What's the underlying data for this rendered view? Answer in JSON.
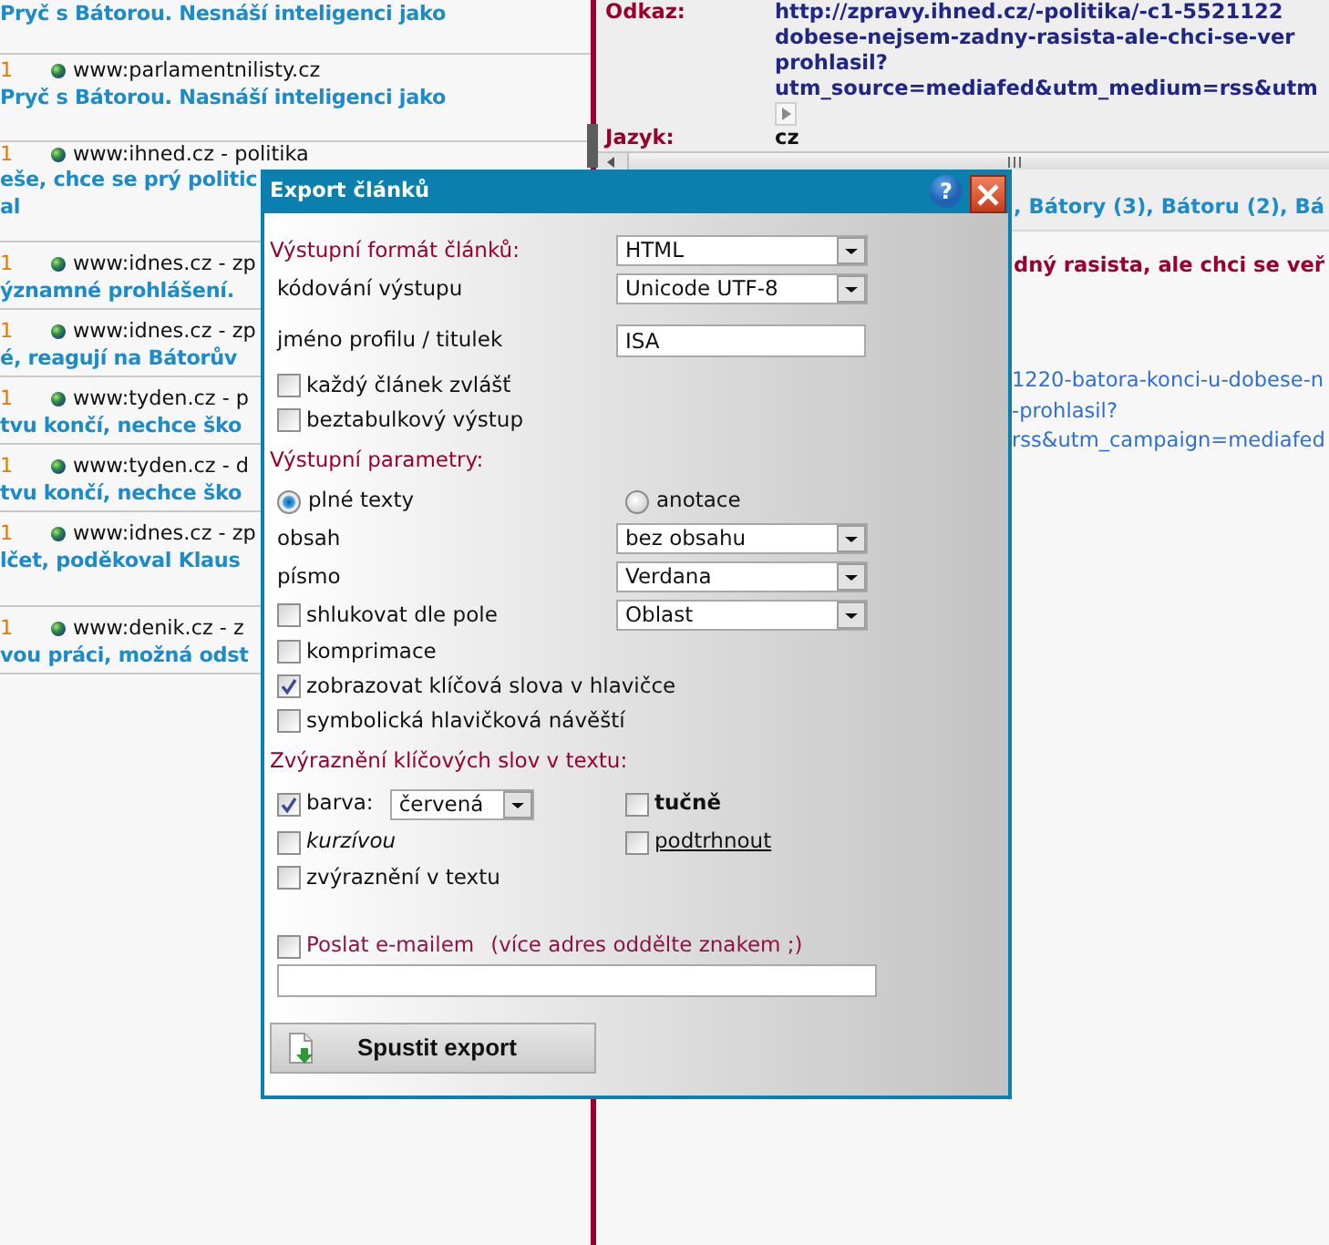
{
  "article_list": [
    {
      "title_lines": [
        "Pryč s Bátorou. Nesnáší inteligenci jako"
      ]
    },
    {
      "count": "1",
      "source": "www:parlamentnilisty.cz",
      "title_lines": [
        "Pryč s Bátorou. Nasnáší inteligenci jako"
      ]
    },
    {
      "count": "1",
      "source": "www:ihned.cz - politika",
      "title_lines": [
        "eše, chce se prý politic",
        "al"
      ]
    },
    {
      "count": "1",
      "source": "www:idnes.cz - zp",
      "title_lines": [
        "ýznamné prohlášení."
      ]
    },
    {
      "count": "1",
      "source": "www:idnes.cz - zp",
      "title_lines": [
        "é, reagují na Bátorův"
      ]
    },
    {
      "count": "1",
      "source": "www:tyden.cz - p",
      "title_lines": [
        "tvu končí, nechce ško"
      ]
    },
    {
      "count": "1",
      "source": "www:tyden.cz - d",
      "title_lines": [
        "tvu končí, nechce ško"
      ]
    },
    {
      "count": "1",
      "source": "www:idnes.cz - zp",
      "title_lines": [
        "lčet, poděkoval Klaus"
      ]
    },
    {
      "count": "1",
      "source": "www:denik.cz - z",
      "title_lines": [
        "vou práci, možná odst"
      ]
    }
  ],
  "detail": {
    "fields": [
      {
        "kind": "link",
        "label": "Odkaz:",
        "lines": [
          "http://zpravy.ihned.cz/-politika/-c1-5521122",
          "dobese-nejsem-zadny-rasista-ale-chci-se-ver",
          "prohlasil?",
          "utm_source=mediafed&utm_medium=rss&utm"
        ]
      },
      {
        "kind": "text",
        "label": "Jazyk:",
        "lines": [
          "cz"
        ]
      }
    ]
  },
  "article_preview": {
    "keywords": ", Bátory (3), Bátoru (2), Bá",
    "headline": "dný rasista, ale chci se veř",
    "link_lines": [
      "1220-batora-konci-u-dobese-n",
      "-prohlasil?",
      "rss&utm_campaign=mediafed"
    ]
  },
  "dialog": {
    "title": "Export článků",
    "help": "?",
    "rows": [
      {
        "kind": "select",
        "label": "Výstupní formát článků:",
        "accent": true,
        "value": "HTML"
      },
      {
        "kind": "select",
        "label": "kódování výstupu",
        "accent": false,
        "value": "Unicode UTF-8"
      },
      {
        "kind": "text",
        "label": "jméno profilu / titulek",
        "value": "ISA"
      },
      {
        "kind": "checkbox",
        "label": "každý článek zvlášť",
        "checked": false
      },
      {
        "kind": "checkbox",
        "label": "beztabulkový výstup",
        "checked": false
      },
      {
        "kind": "heading",
        "label": "Výstupní parametry:"
      },
      {
        "kind": "radios",
        "options": [
          {
            "label": "plné texty",
            "selected": true
          },
          {
            "label": "anotace",
            "selected": false
          }
        ]
      },
      {
        "kind": "select",
        "label": "obsah",
        "accent": false,
        "value": "bez obsahu"
      },
      {
        "kind": "select",
        "label": "písmo",
        "accent": false,
        "value": "Verdana"
      },
      {
        "kind": "checkbox_select",
        "label": "shlukovat dle pole",
        "checked": false,
        "value": "Oblast"
      },
      {
        "kind": "checkbox",
        "label": "komprimace",
        "checked": false
      },
      {
        "kind": "checkbox",
        "label": "zobrazovat klíčová slova v hlavičce",
        "checked": true
      },
      {
        "kind": "checkbox",
        "label": "symbolická hlavičková návěští",
        "checked": false
      },
      {
        "kind": "heading",
        "label": "Zvýraznění klíčových slov v textu:"
      },
      {
        "kind": "pair",
        "cells": [
          {
            "kind": "checkbox_select",
            "label": "barva:",
            "checked": true,
            "value": "červená"
          },
          {
            "kind": "checkbox",
            "label": "tučně",
            "checked": false,
            "bold": true
          }
        ]
      },
      {
        "kind": "pair",
        "cells": [
          {
            "kind": "checkbox",
            "label": "kurzívou",
            "checked": false,
            "italic": true
          },
          {
            "kind": "checkbox",
            "label": "podtrhnout",
            "checked": false,
            "underline": true
          }
        ]
      },
      {
        "kind": "checkbox",
        "label": "zvýraznění v textu",
        "checked": false
      }
    ],
    "email": {
      "label": "Poslat e-mailem",
      "hint": "(více adres oddělte znakem ;)",
      "checked": false
    },
    "submit": "Spustit export"
  }
}
